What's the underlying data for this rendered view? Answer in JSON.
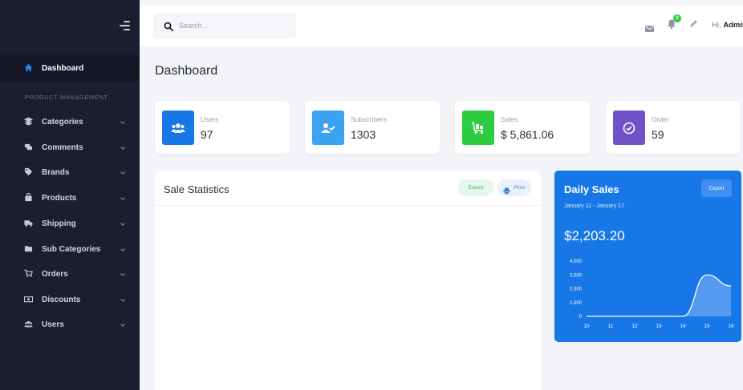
{
  "sidebar": {
    "section_label": "PRODUCT MANAGEMENT",
    "items": [
      {
        "label": "Dashboard",
        "icon": "home-icon"
      },
      {
        "label": "Categories",
        "icon": "layers-icon"
      },
      {
        "label": "Comments",
        "icon": "comments-icon"
      },
      {
        "label": "Brands",
        "icon": "tag-icon"
      },
      {
        "label": "Products",
        "icon": "bag-icon"
      },
      {
        "label": "Shipping",
        "icon": "truck-icon"
      },
      {
        "label": "Sub Categories",
        "icon": "folder-icon"
      },
      {
        "label": "Orders",
        "icon": "cart-icon"
      },
      {
        "label": "Discounts",
        "icon": "money-icon"
      },
      {
        "label": "Users",
        "icon": "users-icon"
      }
    ]
  },
  "topbar": {
    "search_placeholder": "Search...",
    "notification_count": "0",
    "greeting_prefix": "Hi,",
    "user_name": "Admin"
  },
  "page": {
    "title": "Dashboard"
  },
  "stats": [
    {
      "label": "Users",
      "value": "97",
      "color": "#1877e6",
      "icon": "users-icon"
    },
    {
      "label": "Subscribers",
      "value": "1303",
      "color": "#3ba3f0",
      "icon": "user-check-icon"
    },
    {
      "label": "Sales",
      "value": "$ 5,861.06",
      "color": "#2ecc40",
      "icon": "shopping-cart-icon"
    },
    {
      "label": "Order",
      "value": "59",
      "color": "#6f51c8",
      "icon": "check-circle-icon"
    }
  ],
  "sale_statistics": {
    "title": "Sale Statistics",
    "export_label": "Export",
    "print_label": "Print"
  },
  "daily_sales": {
    "title": "Daily Sales",
    "date_range": "January 11 - January 17",
    "amount": "$2,203.20",
    "export_label": "Export"
  },
  "chart_data": {
    "type": "area",
    "title": "",
    "x": [
      10,
      11,
      12,
      13,
      14,
      15,
      16
    ],
    "values": [
      0,
      0,
      0,
      0,
      0,
      3000,
      2200
    ],
    "ylim": [
      0,
      4000
    ],
    "y_ticks": [
      "4,000",
      "3,000",
      "2,000",
      "1,000",
      "0"
    ],
    "x_ticks": [
      "10",
      "11",
      "12",
      "13",
      "14",
      "15",
      "16"
    ],
    "grid": false,
    "colors": {
      "line": "#ffffff",
      "fill": "#5b9ff0"
    }
  },
  "colors": {
    "sidebar_bg": "#1b1e2e",
    "accent": "#1877e6",
    "success": "#2ecc40"
  }
}
